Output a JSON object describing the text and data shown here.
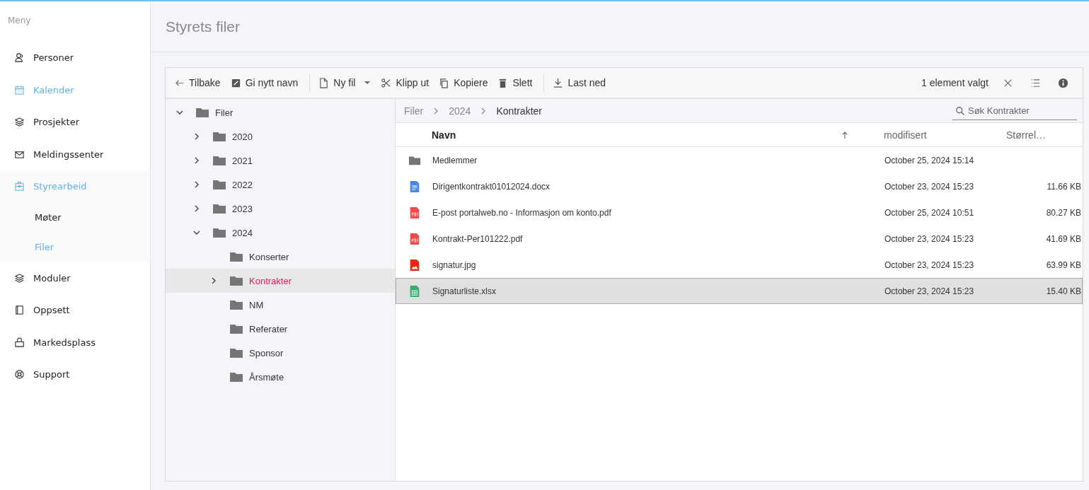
{
  "sidebar": {
    "heading": "Meny",
    "items": [
      {
        "kind": "person",
        "label": "Personer",
        "highlighted": false
      },
      {
        "kind": "calendar",
        "label": "Kalender",
        "highlighted": true
      },
      {
        "kind": "layers",
        "label": "Prosjekter",
        "highlighted": false
      },
      {
        "kind": "mail",
        "label": "Meldingssenter",
        "highlighted": false
      },
      {
        "kind": "briefcase",
        "label": "Styrearbeid",
        "highlighted": true,
        "children": [
          {
            "label": "Møter",
            "selected": false
          },
          {
            "label": "Filer",
            "selected": true
          }
        ]
      },
      {
        "kind": "layers",
        "label": "Moduler",
        "highlighted": false
      },
      {
        "kind": "book",
        "label": "Oppsett",
        "highlighted": false
      },
      {
        "kind": "bag",
        "label": "Markedsplass",
        "highlighted": false
      },
      {
        "kind": "lifebuoy",
        "label": "Support",
        "highlighted": false
      }
    ]
  },
  "page_title": "Styrets filer",
  "toolbar": {
    "groups": [
      [
        {
          "kind": "back",
          "label": "Tilbake"
        },
        {
          "kind": "rename",
          "label": "Gi nytt navn"
        }
      ],
      [
        {
          "kind": "newfile",
          "label": "Ny fil"
        },
        {
          "kind": "cut",
          "label": "Klipp ut"
        },
        {
          "kind": "copy",
          "label": "Kopiere"
        },
        {
          "kind": "delete",
          "label": "Slett"
        }
      ],
      [
        {
          "kind": "download",
          "label": "Last ned"
        }
      ]
    ],
    "selection": "1 element valgt"
  },
  "tree": [
    {
      "label": "Filer",
      "has_children": true,
      "expanded": true,
      "selected": false,
      "children": [
        {
          "label": "2020",
          "has_children": true,
          "expanded": false,
          "selected": false
        },
        {
          "label": "2021",
          "has_children": true,
          "expanded": false,
          "selected": false
        },
        {
          "label": "2022",
          "has_children": true,
          "expanded": false,
          "selected": false
        },
        {
          "label": "2023",
          "has_children": true,
          "expanded": false,
          "selected": false
        },
        {
          "label": "2024",
          "has_children": true,
          "expanded": true,
          "selected": false,
          "children": [
            {
              "label": "Konserter",
              "has_children": false,
              "selected": false
            },
            {
              "label": "Kontrakter",
              "has_children": true,
              "expanded": false,
              "selected": true
            },
            {
              "label": "NM",
              "has_children": false,
              "selected": false
            },
            {
              "label": "Referater",
              "has_children": false,
              "selected": false
            },
            {
              "label": "Sponsor",
              "has_children": false,
              "selected": false
            },
            {
              "label": "Årsmøte",
              "has_children": false,
              "selected": false
            }
          ]
        }
      ]
    }
  ],
  "breadcrumb": [
    "Filer",
    "2024",
    "Kontrakter"
  ],
  "search": {
    "placeholder": "Søk Kontrakter"
  },
  "table": {
    "columns": [
      {
        "label": "Navn",
        "sorted": true
      },
      {
        "label": "modifisert",
        "sorted": false
      },
      {
        "label": "Størrel…",
        "sorted": false
      }
    ],
    "rows": [
      {
        "kind": "folder",
        "name": "Medlemmer",
        "modified": "October 25, 2024 15:14",
        "size": "",
        "selected": false
      },
      {
        "kind": "docx",
        "name": "Dirigentkontrakt01012024.docx",
        "modified": "October 23, 2024 15:23",
        "size": "11.66 KB",
        "selected": false
      },
      {
        "kind": "pdf",
        "name": "E-post portalweb.no - Informasjon om konto.pdf",
        "modified": "October 25, 2024 10:51",
        "size": "80.27 KB",
        "selected": false
      },
      {
        "kind": "pdf",
        "name": "Kontrakt-Per101222.pdf",
        "modified": "October 23, 2024 15:23",
        "size": "41.69 KB",
        "selected": false
      },
      {
        "kind": "image",
        "name": "signatur.jpg",
        "modified": "October 23, 2024 15:23",
        "size": "63.99 KB",
        "selected": false
      },
      {
        "kind": "sheet",
        "name": "Signaturliste.xlsx",
        "modified": "October 23, 2024 15:23",
        "size": "15.40 KB",
        "selected": true
      }
    ]
  }
}
